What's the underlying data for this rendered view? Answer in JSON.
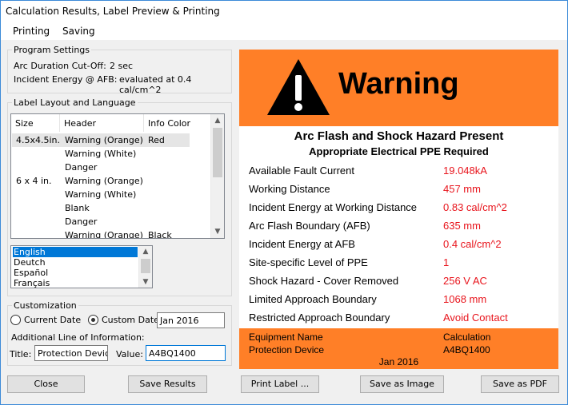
{
  "window": {
    "title": "Calculation Results, Label Preview & Printing"
  },
  "menu": {
    "items": [
      "Printing",
      "Saving"
    ]
  },
  "program_settings": {
    "legend": "Program Settings",
    "cutoff_label": "Arc Duration Cut-Off:",
    "cutoff_value": "2 sec",
    "ie_label": "Incident Energy @ AFB:",
    "ie_value": "evaluated at 0.4 cal/cm^2"
  },
  "layout": {
    "legend": "Label Layout and Language",
    "columns": [
      "Size",
      "Header",
      "Info Color"
    ],
    "rows": [
      {
        "size": "4.5x4.5in.",
        "header": "Warning (Orange)",
        "color": "Red"
      },
      {
        "size": "",
        "header": "Warning (White)",
        "color": ""
      },
      {
        "size": "",
        "header": "Danger",
        "color": ""
      },
      {
        "size": "6 x 4 in.",
        "header": "Warning (Orange)",
        "color": ""
      },
      {
        "size": "",
        "header": "Warning (White)",
        "color": ""
      },
      {
        "size": "",
        "header": "Blank",
        "color": ""
      },
      {
        "size": "",
        "header": "Danger",
        "color": ""
      },
      {
        "size": "",
        "header": "Warning (Orange)",
        "color": "Black"
      }
    ],
    "languages": [
      "English",
      "Deutch",
      "Español",
      "Français"
    ]
  },
  "customization": {
    "legend": "Customization",
    "current_date_label": "Current Date",
    "custom_date_label": "Custom Date",
    "custom_date_value": "Jan 2016",
    "additional_line_label": "Additional Line of Information:",
    "title_label": "Title:",
    "title_value": "Protection Device",
    "value_label": "Value:",
    "value_value": "A4BQ1400"
  },
  "label": {
    "header": "Warning",
    "line1": "Arc Flash and Shock Hazard Present",
    "line2": "Appropriate Electrical PPE Required",
    "rows": [
      {
        "label": "Available Fault Current",
        "value": "19.048kA"
      },
      {
        "label": "Working Distance",
        "value": "457 mm"
      },
      {
        "label": "Incident Energy at Working Distance",
        "value": "0.83 cal/cm^2"
      },
      {
        "label": "Arc Flash Boundary (AFB)",
        "value": "635 mm"
      },
      {
        "label": "Incident Energy at AFB",
        "value": "0.4 cal/cm^2"
      },
      {
        "label": "Site-specific Level of PPE",
        "value": "1"
      },
      {
        "label": "Shock Hazard - Cover Removed",
        "value": "256 V AC"
      },
      {
        "label": "Limited Approach Boundary",
        "value": "1068 mm"
      },
      {
        "label": "Restricted Approach Boundary",
        "value": "Avoid Contact"
      }
    ],
    "footer": {
      "equip_label": "Equipment Name",
      "equip_value": "Calculation",
      "prot_label": "Protection Device",
      "prot_value": "A4BQ1400",
      "date": "Jan 2016"
    },
    "colors": {
      "orange": "#ff7f27",
      "value_red": "#e8141c"
    }
  },
  "buttons": {
    "close": "Close",
    "save_results": "Save Results",
    "print_label": "Print Label ...",
    "save_image": "Save as Image",
    "save_pdf": "Save as PDF"
  }
}
